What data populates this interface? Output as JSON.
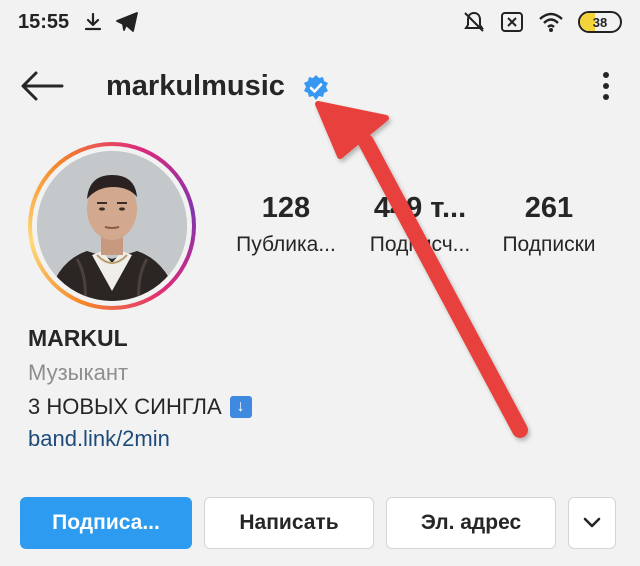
{
  "status_bar": {
    "time": "15:55",
    "battery_level": "38",
    "battery_fraction": 0.38,
    "icons": [
      "download-icon",
      "telegram-icon",
      "mute-icon",
      "sim-off-icon",
      "wifi-icon",
      "battery-icon"
    ]
  },
  "header": {
    "username": "markulmusic",
    "verified": true,
    "icons": [
      "back-arrow-icon",
      "verified-badge-icon",
      "more-vertical-icon"
    ]
  },
  "stats": [
    {
      "value": "128",
      "label": "Публика..."
    },
    {
      "value": "449 т...",
      "label": "Подписч..."
    },
    {
      "value": "261",
      "label": "Подписки"
    }
  ],
  "bio": {
    "name": "MARKUL",
    "category": "Музыкант",
    "text": "3 НОВЫХ СИНГЛА",
    "text_icon": "arrow-down-emoji-icon",
    "link": "band.link/2min"
  },
  "buttons": {
    "follow": "Подписа...",
    "message": "Написать",
    "email": "Эл. адрес",
    "more_icon": "chevron-down-icon"
  },
  "colors": {
    "follow_button": "#2d9cf0",
    "verified_badge": "#3897f0",
    "link": "#1f4b7a",
    "annotation_arrow": "#e8413c",
    "battery_fill": "#f4d33a"
  }
}
